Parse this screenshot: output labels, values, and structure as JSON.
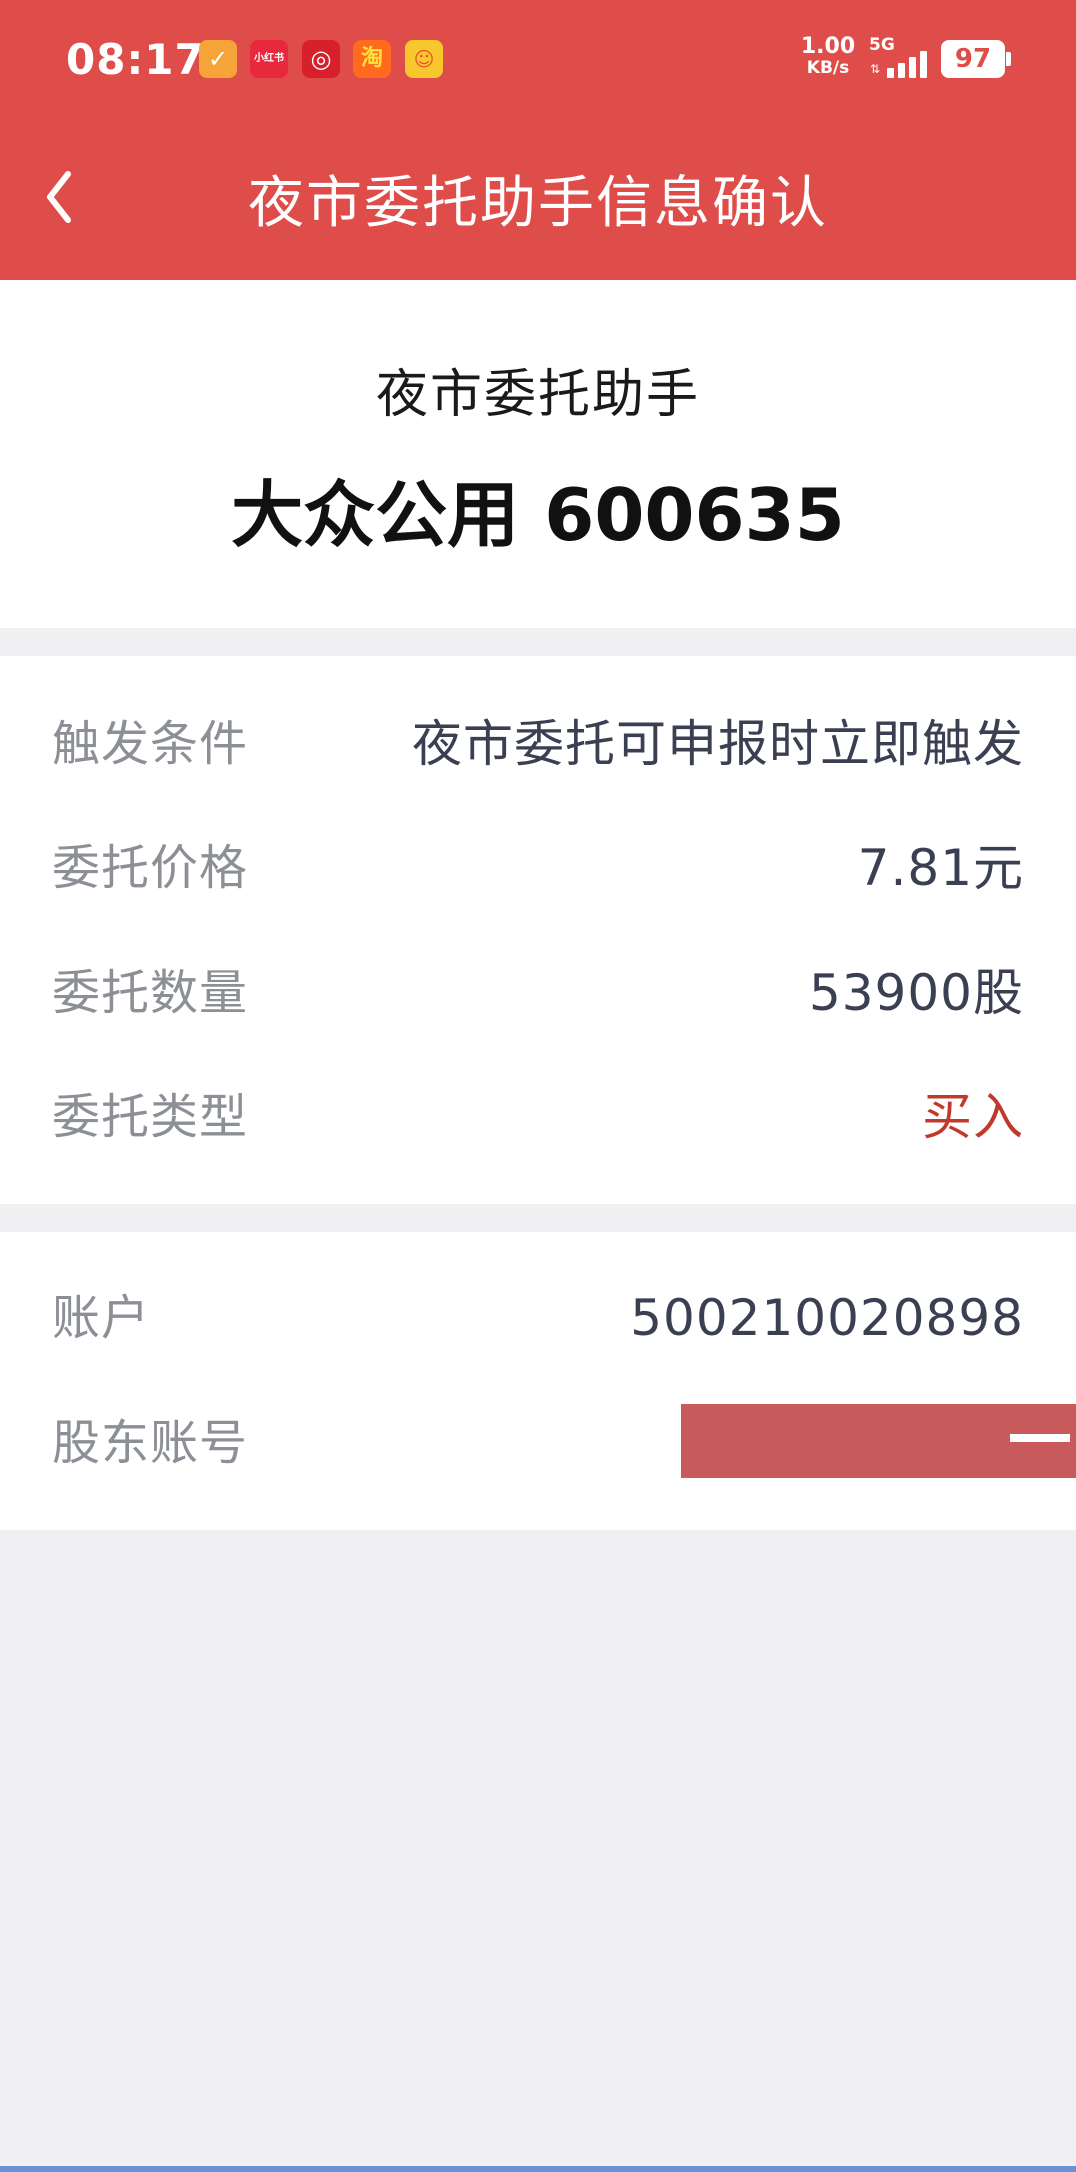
{
  "status_bar": {
    "time": "08:17",
    "apps": [
      {
        "name": "app-1",
        "glyph": "✓"
      },
      {
        "name": "xiaohongshu",
        "glyph": "小红书"
      },
      {
        "name": "app-3",
        "glyph": "◎"
      },
      {
        "name": "taobao",
        "glyph": "淘"
      },
      {
        "name": "app-5",
        "glyph": "☺"
      }
    ],
    "net_speed": "1.00",
    "net_speed_unit": "KB/s",
    "network": "5G",
    "battery": "97"
  },
  "nav": {
    "title": "夜市委托助手信息确认",
    "back_icon": "chevron-left-icon"
  },
  "stock": {
    "subtitle": "夜市委托助手",
    "name_code": "大众公用 600635"
  },
  "order": {
    "rows": [
      {
        "label": "触发条件",
        "value": "夜市委托可申报时立即触发"
      },
      {
        "label": "委托价格",
        "value": "7.81元"
      },
      {
        "label": "委托数量",
        "value": "53900股"
      },
      {
        "label": "委托类型",
        "value": "买入"
      }
    ]
  },
  "account": {
    "rows": [
      {
        "label": "账户",
        "value": "500210020898"
      },
      {
        "label": "股东账号",
        "value": ""
      }
    ]
  },
  "colors": {
    "header": "#df4d4a",
    "buy": "#c0392b",
    "label": "#8c8f96",
    "value": "#3a3f52"
  }
}
